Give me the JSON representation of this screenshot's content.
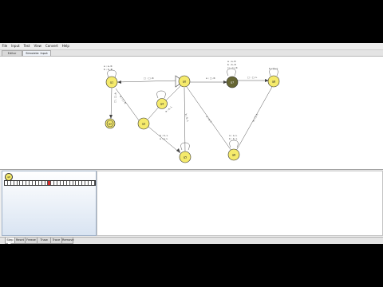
{
  "menu": [
    "File",
    "Input",
    "Test",
    "View",
    "Convert",
    "Help"
  ],
  "top_tabs": [
    {
      "label": "Editor",
      "active": false
    },
    {
      "label": "Simulate: Input",
      "active": true
    }
  ],
  "bottom_tabs": [
    {
      "label": "Step",
      "active": true
    },
    {
      "label": "Reset",
      "active": false
    },
    {
      "label": "Freeze",
      "active": false
    },
    {
      "label": "Thaw",
      "active": false
    },
    {
      "label": "Trace",
      "active": false
    },
    {
      "label": "Remove",
      "active": false
    }
  ],
  "states": [
    {
      "id": "q0",
      "label": "q0",
      "current": false
    },
    {
      "id": "q1",
      "label": "q1",
      "current": false
    },
    {
      "id": "q2",
      "label": "q2",
      "current": false
    },
    {
      "id": "q3",
      "label": "q3",
      "current": false
    },
    {
      "id": "q4",
      "label": "q4",
      "current": false
    },
    {
      "id": "q5",
      "label": "q5",
      "current": false
    },
    {
      "id": "q6",
      "label": "q6",
      "current": false
    },
    {
      "id": "q7",
      "label": "q7",
      "current": true
    },
    {
      "id": "q8",
      "label": "q8",
      "current": false
    }
  ],
  "colors": {
    "state_fill": "#f5ea6c",
    "state_current": "#666633",
    "edge": "#555555",
    "tape_head": "#d42a2a",
    "panel_gradient_bottom": "#d9e4f2"
  },
  "sim": {
    "state_label": "q0",
    "tape": [
      "",
      "",
      "",
      "",
      "",
      "",
      "",
      "",
      "",
      "",
      "",
      "",
      "",
      "",
      "",
      "",
      "",
      "",
      "",
      "",
      "",
      "",
      "",
      "",
      "",
      "",
      "",
      "",
      ""
    ],
    "head_index": 14
  }
}
